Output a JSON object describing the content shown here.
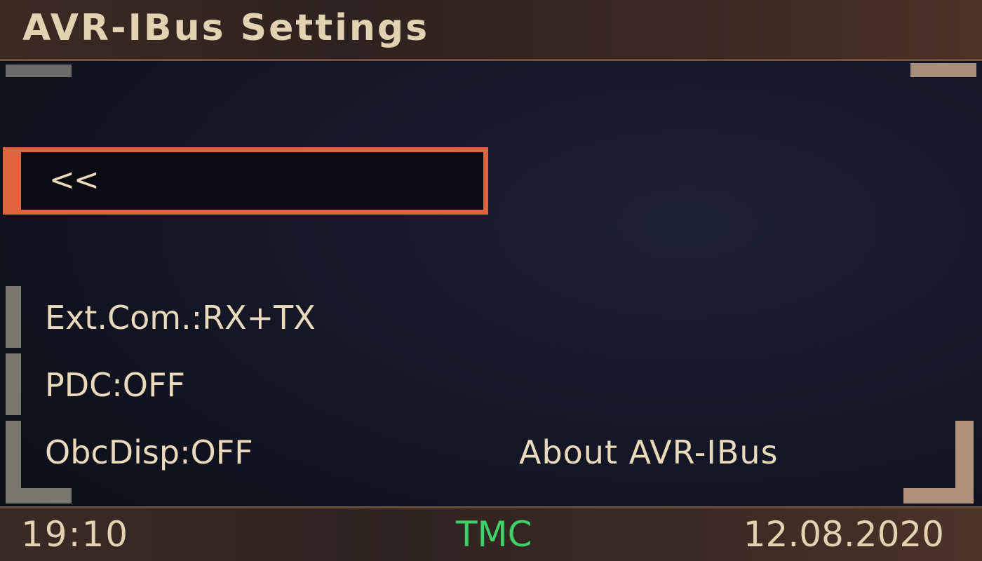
{
  "header": {
    "title": "AVR-IBus Settings"
  },
  "menu": {
    "back_label": "<<",
    "items": [
      {
        "label": "Ext.Com.:RX+TX"
      },
      {
        "label": "PDC:OFF"
      },
      {
        "label": "ObcDisp:OFF"
      }
    ],
    "about_label": "About  AVR-IBus"
  },
  "status": {
    "time": "19:10",
    "indicator": "TMC",
    "date": "12.08.2020"
  },
  "colors": {
    "highlight": "#e0623e",
    "text": "#eadabb",
    "tmc": "#3fd06a",
    "header_bg": "#3b2a22",
    "screen_bg": "#141726"
  }
}
